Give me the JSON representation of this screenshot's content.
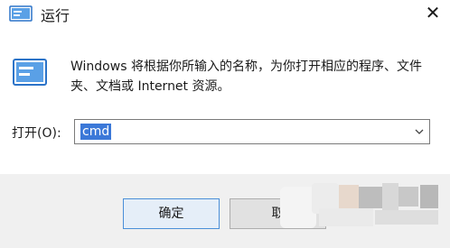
{
  "window": {
    "title": "运行",
    "close_label": "✕"
  },
  "body": {
    "description": "Windows 将根据你所输入的名称，为你打开相应的程序、文件夹、文档或 Internet 资源。"
  },
  "open_field": {
    "label": "打开(O):",
    "value": "cmd"
  },
  "buttons": {
    "ok_label": "确定",
    "cancel_label": "取"
  },
  "icons": {
    "title": "run-dialog-icon",
    "body": "run-dialog-icon",
    "close": "close-icon",
    "dropdown": "chevron-down-icon"
  },
  "colors": {
    "selection": "#3b78d8",
    "icon_blue": "#2b73c8",
    "button_face": "#e1e1e1",
    "ok_border": "#4a8fd8"
  }
}
